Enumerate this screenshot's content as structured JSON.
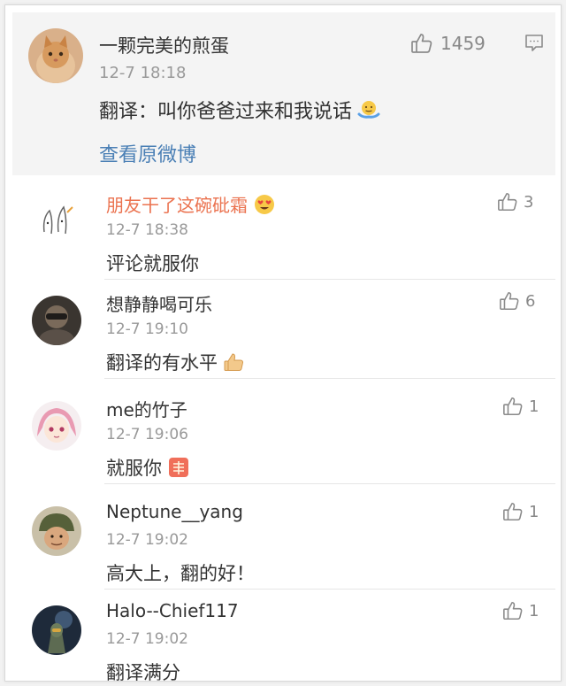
{
  "main_post": {
    "author": "一颗完美的煎蛋",
    "time": "12-7 18:18",
    "text": "翻译：叫你爸爸过来和我说话",
    "text_emoji": "shrug-emoji",
    "view_link": "查看原微博",
    "likes": "1459",
    "icons": {
      "like": "thumbs-up-icon",
      "comment": "comment-icon"
    }
  },
  "comments": [
    {
      "author": "朋友干了这碗砒霜",
      "author_emoji": "heart-eyes-emoji",
      "time": "12-7 18:38",
      "text": "评论就服你",
      "likes": "3"
    },
    {
      "author": "想静静喝可乐",
      "time": "12-7 19:10",
      "text": "翻译的有水平",
      "text_emoji": "thumbs-up-emoji",
      "likes": "6"
    },
    {
      "author": "me的竹子",
      "time": "12-7 19:06",
      "text": "就服你",
      "text_emoji": "respect-emoji",
      "likes": "1"
    },
    {
      "author": "Neptune__yang",
      "time": "12-7 19:02",
      "text": "高大上，翻的好！",
      "likes": "1"
    },
    {
      "author": "Halo--Chief117",
      "time": "12-7 19:02",
      "text": "翻译满分",
      "likes": "1"
    }
  ],
  "colors": {
    "link": "#4a7fb5",
    "highlight_name": "#eb7350",
    "meta_gray": "#999999",
    "main_bg": "#f4f4f4"
  }
}
